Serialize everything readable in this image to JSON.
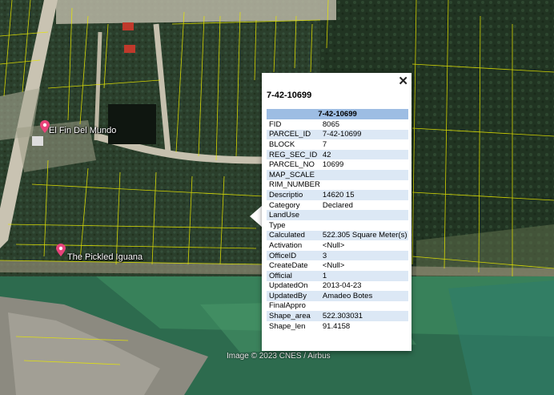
{
  "map": {
    "attribution": "Image © 2023 CNES / Airbus",
    "pois": [
      {
        "name": "El Fin Del Mundo",
        "icon": "food-pin-icon"
      },
      {
        "name": "The Pickled Iguana",
        "icon": "food-pin-icon"
      }
    ],
    "colors": {
      "parcel_lines": "#e6e600",
      "pin": "#e8437a",
      "popup_header": "#9dbde3",
      "row_alt": "#dce8f5"
    }
  },
  "popup": {
    "title": "7-42-10699",
    "close_glyph": "✕",
    "table_header": "7-42-10699",
    "rows": [
      {
        "key": "FID",
        "value": "8065"
      },
      {
        "key": "PARCEL_ID",
        "value": "7-42-10699"
      },
      {
        "key": "BLOCK",
        "value": "7"
      },
      {
        "key": "REG_SEC_ID",
        "value": "42"
      },
      {
        "key": "PARCEL_NO",
        "value": "10699"
      },
      {
        "key": "MAP_SCALE",
        "value": ""
      },
      {
        "key": "RIM_NUMBER",
        "value": ""
      },
      {
        "key": "Descriptio",
        "value": "14620 15"
      },
      {
        "key": "Category",
        "value": "Declared"
      },
      {
        "key": "LandUse",
        "value": ""
      },
      {
        "key": "Type",
        "value": ""
      },
      {
        "key": "Calculated",
        "value": "522.305 Square Meter(s)"
      },
      {
        "key": "Activation",
        "value": "<Null>"
      },
      {
        "key": "OfficeID",
        "value": "3"
      },
      {
        "key": "CreateDate",
        "value": "<Null>"
      },
      {
        "key": "Official",
        "value": "1"
      },
      {
        "key": "UpdatedOn",
        "value": "2013-04-23"
      },
      {
        "key": "UpdatedBy",
        "value": "Amadeo Botes"
      },
      {
        "key": "FinalAppro",
        "value": ""
      },
      {
        "key": "Shape_area",
        "value": "522.303031"
      },
      {
        "key": "Shape_len",
        "value": "91.4158"
      }
    ]
  }
}
